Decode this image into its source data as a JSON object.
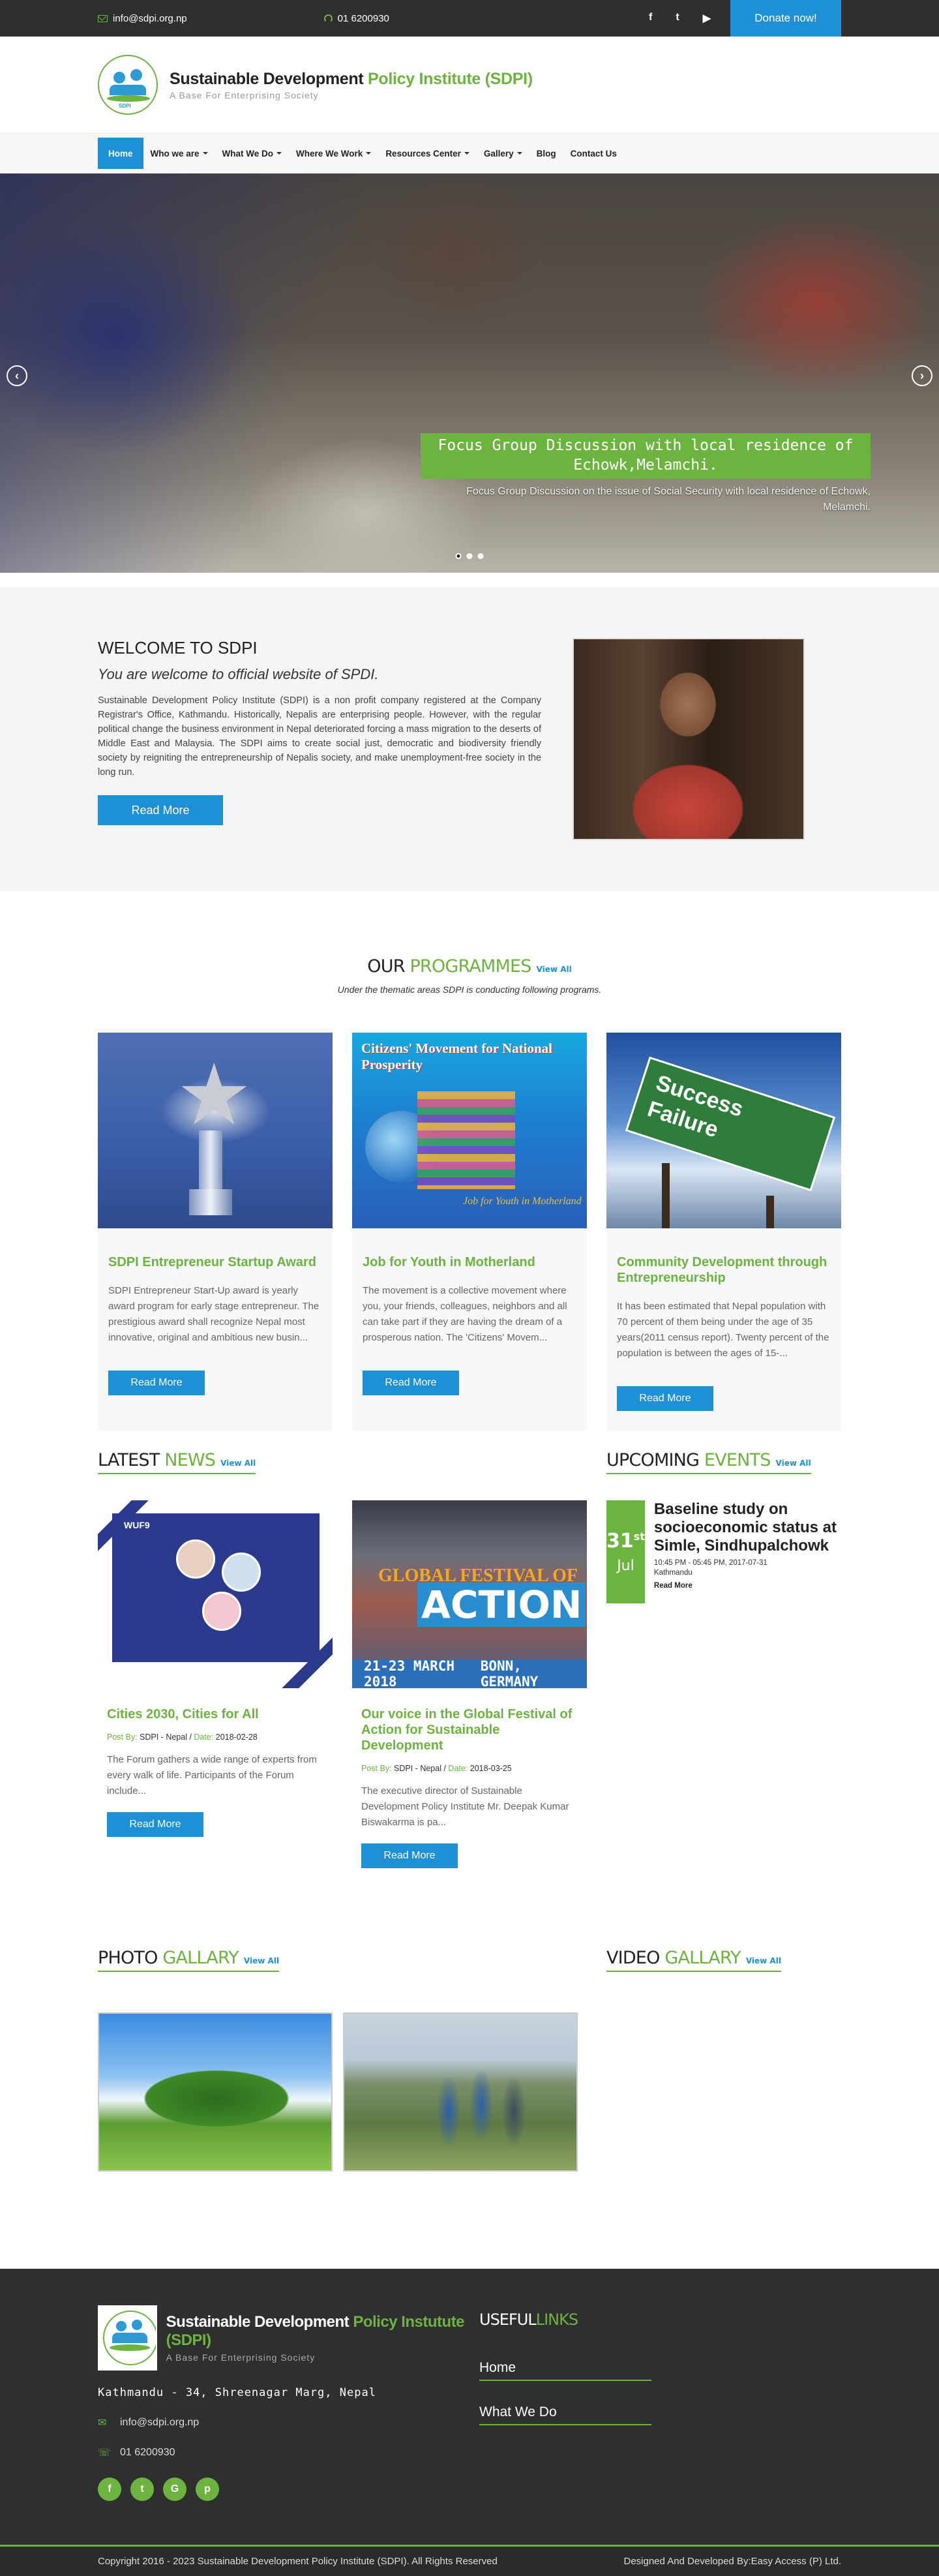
{
  "topbar": {
    "email": "info@sdpi.org.np",
    "phone": "01 6200930",
    "social": [
      "f",
      "t",
      "▶"
    ],
    "donate": "Donate now!"
  },
  "header": {
    "title_main": "Sustainable Development ",
    "title_accent": "Policy Institute (SDPI)",
    "tagline": "A Base For Enterprising Society",
    "logo_text": "SDPI"
  },
  "nav": {
    "items": [
      {
        "label": "Home"
      },
      {
        "label": "Who we are"
      },
      {
        "label": "What We Do"
      },
      {
        "label": "Where We Work"
      },
      {
        "label": "Resources Center"
      },
      {
        "label": "Gallery"
      },
      {
        "label": "Blog"
      },
      {
        "label": "Contact Us"
      }
    ]
  },
  "slider": {
    "title": "Focus Group Discussion with local residence of Echowk,Melamchi.",
    "text": "Focus Group Discussion on the issue of Social Security with local residence of Echowk, Melamchi.",
    "prev": "‹",
    "next": "›"
  },
  "welcome": {
    "title": "WELCOME TO SDPI",
    "subtitle": "You are welcome to official website of SPDI.",
    "body": "Sustainable Development Policy Institute (SDPI) is a non profit company registered at the Company Registrar's Office, Kathmandu. Historically, Nepalis are enterprising people. However, with the regular political change the business environment in Nepal deteriorated forcing a mass migration to the deserts of Middle East and Malaysia. The SDPI aims to create social just, democratic and biodiversity friendly society by reigniting the entrepreneurship of Nepalis society, and make unemployment-free society in the long run.",
    "button": "Read More"
  },
  "programmes": {
    "title_a": "OUR ",
    "title_b": "PROGRAMMES",
    "view_all": "View All",
    "subtitle": "Under the thematic areas SDPI is conducting following programs.",
    "cards": [
      {
        "title": "SDPI Entrepreneur Startup Award",
        "desc": "SDPI Entrepreneur Start-Up award is yearly award program for early stage entrepreneur. The prestigious award shall recognize Nepal most innovative, original and ambitious new busin...",
        "button": "Read More"
      },
      {
        "title": "Job for Youth in Motherland",
        "desc": "The movement is a collective movement where you, your friends, colleagues, neighbors and all can take part if they are having the dream of a prosperous nation. The 'Citizens' Movem...",
        "button": "Read More",
        "img_title": "Citizens' Movement for National Prosperity",
        "img_sub": "Job for Youth in Motherland"
      },
      {
        "title": "Community Development through Entrepreneurship",
        "desc": "It has been estimated that Nepal population with 70 percent of them being under the age of 35 years(2011 census report). Twenty percent of the population is between the ages of 15-...",
        "button": "Read More",
        "img_sign": "Success Failure"
      }
    ]
  },
  "news": {
    "title_a": "LATEST ",
    "title_b": "NEWS",
    "view_all": "View All",
    "items": [
      {
        "title": "Cities 2030, Cities for All",
        "post_by_label": "Post By:",
        "author": "SDPI - Nepal",
        "date_label": "Date:",
        "date": "2018-02-28",
        "desc": "The Forum gathers a wide range of experts from every walk of life. Participants of the Forum include...",
        "button": "Read More",
        "img_label": "WUF9"
      },
      {
        "title": "Our voice in the Global Festival of Action for Sustainable Development",
        "post_by_label": "Post By:",
        "author": "SDPI - Nepal",
        "date_label": "Date:",
        "date": "2018-03-25",
        "desc": "The executive director of Sustainable Development Policy Institute Mr. Deepak Kumar Biswakarma is pa...",
        "button": "Read More",
        "img_a": "GLOBAL FESTIVAL OF",
        "img_b": "ACTION",
        "img_date": "21-23 MARCH 2018",
        "img_place": "BONN, GERMANY"
      }
    ]
  },
  "events": {
    "title_a": "UPCOMING ",
    "title_b": "EVENTS",
    "view_all": "View All",
    "item": {
      "day": "31",
      "suffix": "st",
      "month": "Jul",
      "title": "Baseline study on socioeconomic status at Simle, Sindhupalchowk",
      "time": "10:45 PM - 05:45 PM, 2017-07-31",
      "location": "Kathmandu",
      "more": "Read More"
    }
  },
  "photo_gallery": {
    "title_a": "PHOTO ",
    "title_b": "GALLARY",
    "view_all": "View All"
  },
  "video_gallery": {
    "title_a": "VIDEO ",
    "title_b": "GALLARY",
    "view_all": "View All"
  },
  "footer": {
    "name_main": "Sustainable Development ",
    "name_accent": "Policy Instutute (SDPI)",
    "tagline": "A Base For Enterprising Society",
    "address": "Kathmandu - 34, Shreenagar Marg, Nepal",
    "email": "info@sdpi.org.np",
    "phone": "01 6200930",
    "social": [
      "f",
      "t",
      "G",
      "p"
    ],
    "links_title_a": "USEFUL",
    "links_title_b": "LINKS",
    "links": [
      "Home",
      "What We Do"
    ],
    "copyright": "Copyright 2016 - 2023 Sustainable Development Policy Institute (SDPI). All Rights Reserved",
    "credit": "Designed And Developed By:Easy Access (P) Ltd."
  },
  "colors": {
    "accent_green": "#6cb33f",
    "accent_blue": "#1e90d6",
    "dark": "#2f2f2f"
  }
}
